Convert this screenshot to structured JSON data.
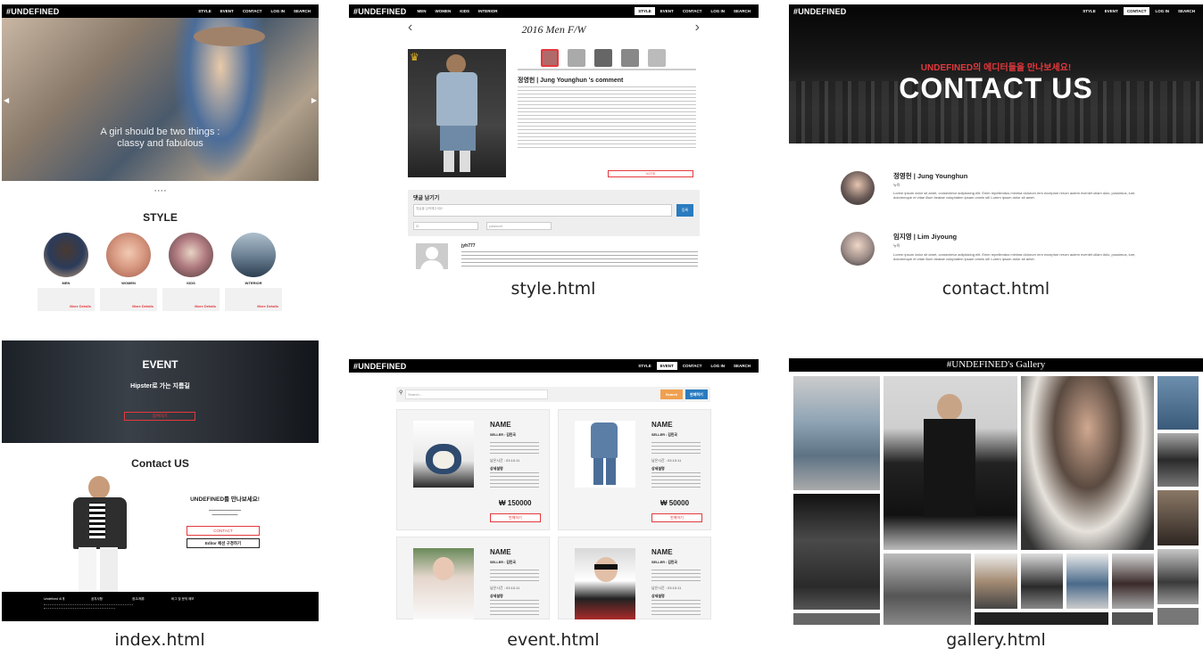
{
  "captions": {
    "index": "index.html",
    "style": "style.html",
    "contact": "contact.html",
    "event": "event.html",
    "gallery": "gallery.html"
  },
  "brand": "#UNDEFINED",
  "nav": {
    "index_items": [
      "STYLE",
      "EVENT",
      "CONTACT",
      "LOG IN",
      "SEARCH"
    ],
    "style_left_items": [
      "MEN",
      "WOMEN",
      "KIDS",
      "INTERIOR"
    ],
    "style_right_items": [
      "STYLE",
      "EVENT",
      "CONTACT",
      "LOG IN",
      "SEARCH"
    ]
  },
  "index": {
    "hero_text_line1": "A girl should be two things :",
    "hero_text_line2": "classy and fabulous",
    "style_title": "STYLE",
    "categories": [
      {
        "label": "MEN",
        "more": "More Details"
      },
      {
        "label": "WOMEN",
        "more": "More Details"
      },
      {
        "label": "KIDS",
        "more": "More Details"
      },
      {
        "label": "INTERIOR",
        "more": "More Details"
      }
    ],
    "event_title": "EVENT",
    "event_sub": "Hipster로 가는 지름길",
    "event_button": "참여하기",
    "contact_title": "Contact US",
    "contact_heading": "UNDEFINED를 만나보세요!",
    "contact_button": "CONTACT",
    "editor_button": "Editor 패션 구경하기",
    "footer_items": [
      "Undefined 소개",
      "공지사항",
      "광고/제휴",
      "버그 및 문의 제보"
    ]
  },
  "style": {
    "season": "2016 Men F/W",
    "comment_title": "정영헌 | Jung Younghun 's comment",
    "vote": "VOTE",
    "comment_box_title": "댓글 남기기",
    "comment_placeholder": "댓글을 입력해주세요",
    "id_placeholder": "ID",
    "pw_placeholder": "password",
    "submit": "등록",
    "commenter": "jyh777"
  },
  "contact": {
    "subtitle": "UNDEFINED의 에디터들을 만나보세요!",
    "title": "CONTACT US",
    "editors": [
      {
        "name": "정영헌 | Jung Younghun",
        "role": "뉴욕"
      },
      {
        "name": "임지영 | Lim Jiyoung",
        "role": "뉴욕"
      }
    ],
    "lorem": "Lorem ipsum dolor sit amet, consectetur adipisicing elit. Enim repellendus minima dolorum rem excepturi rerum autem eveniet ullam dolo, possimus, iure, doloremque et vitae illum beatae voluptatem ipsam omnis sit! Lorem ipsum dolor sit amet."
  },
  "event": {
    "search_placeholder": "Search...",
    "search_btn": "Search",
    "register_btn": "판매하기",
    "nav_items": [
      "STYLE",
      "EVENT",
      "CONTACT",
      "LOG IN",
      "SEARCH"
    ],
    "products": [
      {
        "name": "NAME",
        "seller": "SELLER : 김민국",
        "price": "₩ 150000",
        "buy": "판매하기"
      },
      {
        "name": "NAME",
        "seller": "SELLER : 김민국",
        "price": "₩ 50000",
        "buy": "판매하기"
      },
      {
        "name": "NAME",
        "seller": "SELLER : 김민국",
        "price": "",
        "buy": ""
      },
      {
        "name": "NAME",
        "seller": "SELLER : 김민국",
        "price": "",
        "buy": ""
      }
    ],
    "time": "남은시간 : 03:10:11",
    "desc_label": "상세설명"
  },
  "gallery": {
    "title": "#UNDEFINED's Gallery"
  },
  "colors": {
    "accent_red": "#e4393c",
    "accent_orange": "#f0a050",
    "accent_blue": "#2a7bbf",
    "black": "#000000"
  }
}
